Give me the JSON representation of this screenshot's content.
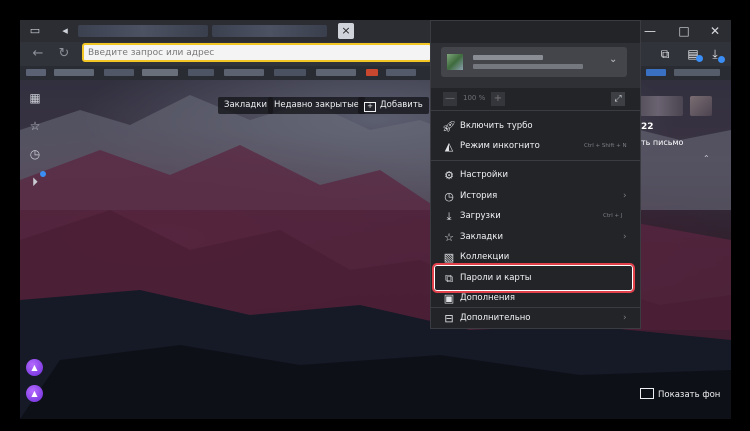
{
  "titlebar": {
    "tab_close": "×",
    "window_controls": [
      "—",
      "□",
      "✕"
    ],
    "menu_icon": "≡"
  },
  "addressbar": {
    "placeholder": "Введите запрос или адрес"
  },
  "newtab": {
    "bookmarks_label": "Закладки",
    "recent_label": "Недавно закрытые",
    "add_label": "Добавить",
    "show_bg_label": "Показать фон",
    "widget_number": "22",
    "widget_text": "ть письмо"
  },
  "menu": {
    "zoom_minus": "—",
    "zoom_value": "100 %",
    "zoom_plus": "+",
    "items": [
      {
        "icon": "rocket-icon",
        "label": "Включить турбо",
        "shortcut": "",
        "arrow": false
      },
      {
        "icon": "incognito-icon",
        "label": "Режим инкогнито",
        "shortcut": "Ctrl + Shift + N",
        "arrow": false
      },
      {
        "icon": "gear-icon",
        "label": "Настройки",
        "shortcut": "",
        "arrow": true
      },
      {
        "icon": "clock-icon",
        "label": "История",
        "shortcut": "",
        "arrow": true
      },
      {
        "icon": "download-icon",
        "label": "Загрузки",
        "shortcut": "Ctrl + J",
        "arrow": false
      },
      {
        "icon": "star-icon",
        "label": "Закладки",
        "shortcut": "",
        "arrow": true
      },
      {
        "icon": "collections-icon",
        "label": "Коллекции",
        "shortcut": "",
        "arrow": false
      },
      {
        "icon": "key-card-icon",
        "label": "Пароли и карты",
        "shortcut": "",
        "arrow": false
      },
      {
        "icon": "extensions-icon",
        "label": "Дополнения",
        "shortcut": "",
        "arrow": false
      },
      {
        "icon": "more-icon",
        "label": "Дополнительно",
        "shortcut": "",
        "arrow": true
      }
    ]
  },
  "colors": {
    "accent_yellow": "#f3c623",
    "highlight_red": "#e2404a",
    "menu_bg": "#232428",
    "badge_blue": "#3a8ef6"
  }
}
